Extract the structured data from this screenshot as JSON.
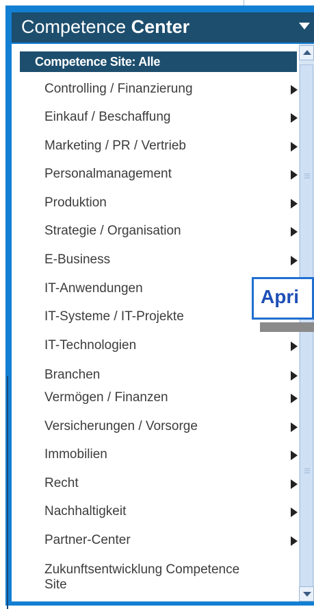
{
  "header": {
    "title_part1": "Competence ",
    "title_part2": "Center"
  },
  "site_bar": {
    "label": "Competence Site: Alle"
  },
  "menu": [
    {
      "label": "Controlling / Finanzierung",
      "has_submenu": true
    },
    {
      "label": "Einkauf / Beschaffung",
      "has_submenu": true
    },
    {
      "label": "Marketing / PR / Vertrieb",
      "has_submenu": true
    },
    {
      "label": "Personalmanagement",
      "has_submenu": true
    },
    {
      "label": "Produktion",
      "has_submenu": true
    },
    {
      "label": "Strategie / Organisation",
      "has_submenu": true
    },
    {
      "label": "E-Business",
      "has_submenu": true
    },
    {
      "label": "IT-Anwendungen",
      "has_submenu": false
    },
    {
      "label": "IT-Systeme / IT-Projekte",
      "has_submenu": false
    },
    {
      "label": "IT-Technologien",
      "has_submenu": true
    },
    {
      "label": "Branchen",
      "has_submenu": true
    },
    {
      "label": "Vermögen / Finanzen",
      "has_submenu": true
    },
    {
      "label": "Versicherungen / Vorsorge",
      "has_submenu": true
    },
    {
      "label": "Immobilien",
      "has_submenu": true
    },
    {
      "label": "Recht",
      "has_submenu": true
    },
    {
      "label": "Nachhaltigkeit",
      "has_submenu": true
    },
    {
      "label": "Partner-Center",
      "has_submenu": true
    },
    {
      "label": "Zukunftsentwicklung Competence Site",
      "has_submenu": false
    }
  ],
  "popup": {
    "text": "Apri"
  },
  "colors": {
    "frame": "#137fd2",
    "header": "#1d4e6e",
    "popup_border": "#1f6fd0"
  },
  "icons": {
    "header": "chevron-down-icon",
    "item": "chevron-right-icon"
  }
}
